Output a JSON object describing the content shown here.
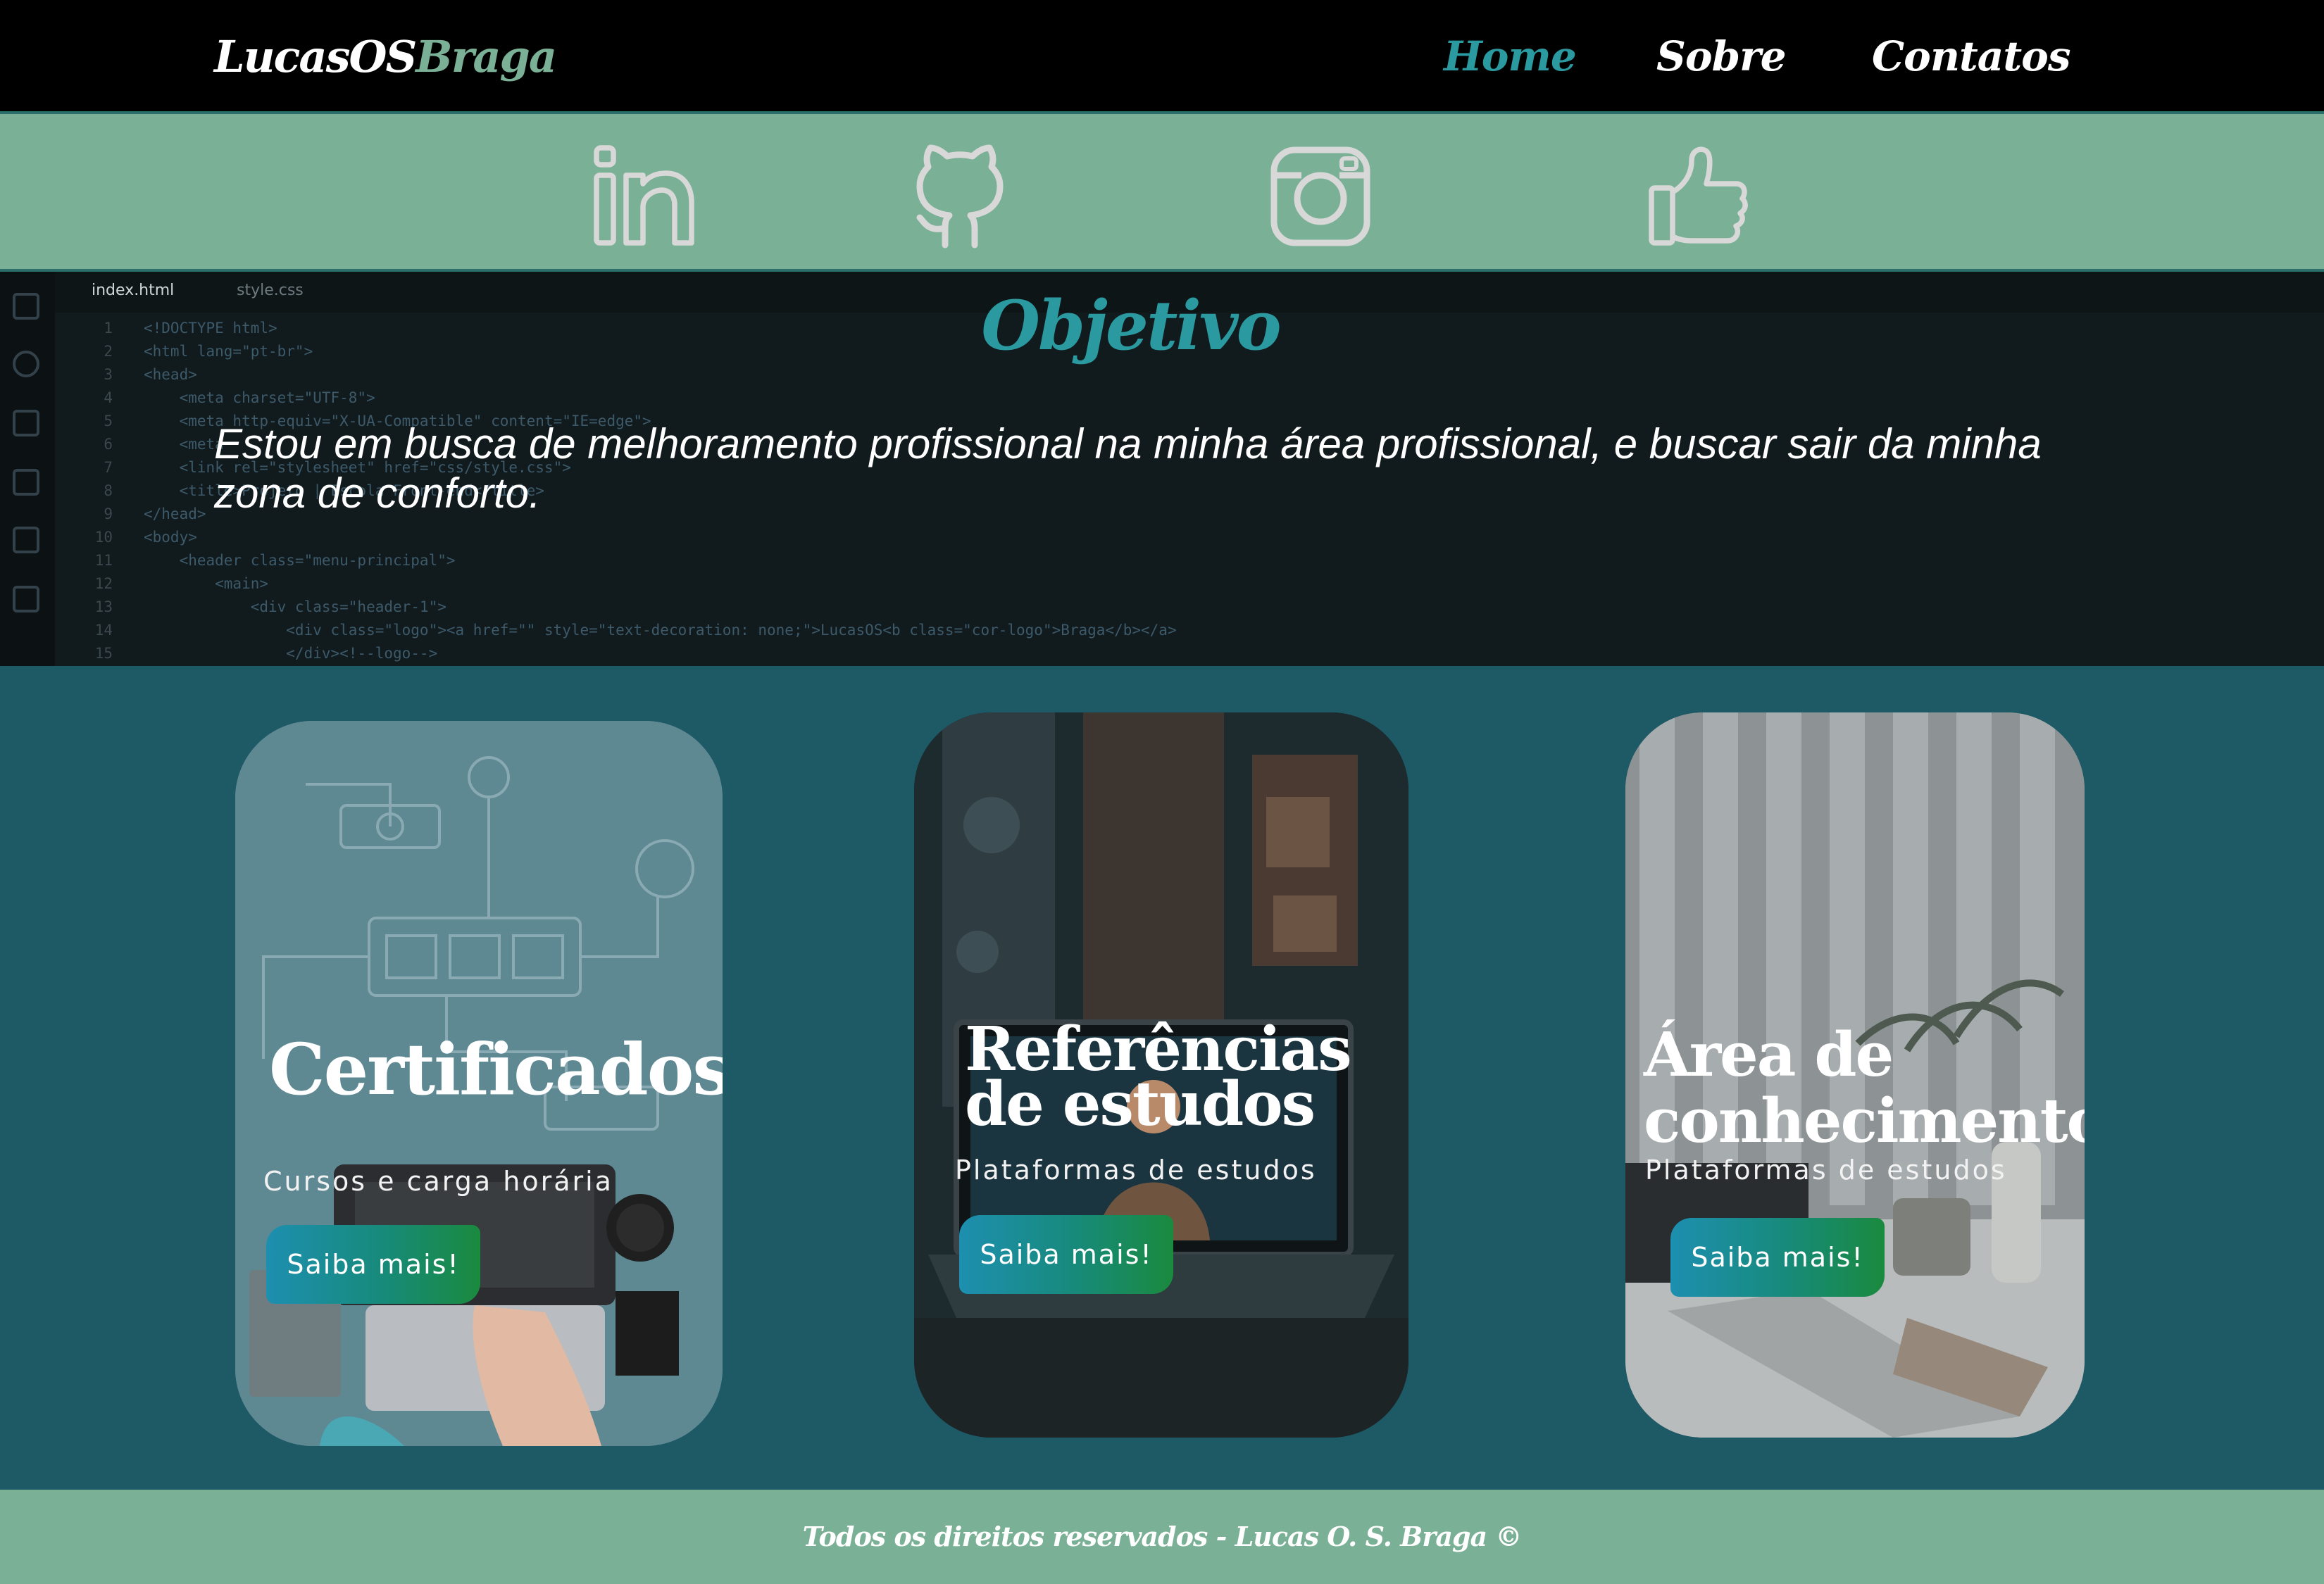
{
  "navbar": {
    "logo_main": "LucasOS",
    "logo_accent": "Braga",
    "links": [
      {
        "label": "Home",
        "active": true
      },
      {
        "label": "Sobre",
        "active": false
      },
      {
        "label": "Contatos",
        "active": false
      }
    ]
  },
  "social": {
    "icons": [
      "linkedin-icon",
      "github-icon",
      "instagram-icon",
      "thumbs-up-icon"
    ]
  },
  "hero": {
    "editor_tabs": [
      "index.html",
      "style.css"
    ],
    "code_lines": [
      {
        "n": "1",
        "text": "<!DOCTYPE html>"
      },
      {
        "n": "2",
        "text": "<html lang=\"pt-br\">"
      },
      {
        "n": "3",
        "text": "<head>"
      },
      {
        "n": "4",
        "text": "    <meta charset=\"UTF-8\">"
      },
      {
        "n": "5",
        "text": "    <meta http-equiv=\"X-UA-Compatible\" content=\"IE=edge\">"
      },
      {
        "n": "6",
        "text": "    <meta"
      },
      {
        "n": "7",
        "text": "    <link rel=\"stylesheet\" href=\"css/style.css\">"
      },
      {
        "n": "8",
        "text": "    <title>Projeto | Escola Front-end</title>"
      },
      {
        "n": "9",
        "text": "</head>"
      },
      {
        "n": "10",
        "text": "<body>"
      },
      {
        "n": "11",
        "text": "    <header class=\"menu-principal\">"
      },
      {
        "n": "12",
        "text": "        <main>"
      },
      {
        "n": "13",
        "text": "            <div class=\"header-1\">"
      },
      {
        "n": "14",
        "text": "                <div class=\"logo\"><a href=\"\" style=\"text-decoration: none;\">LucasOS<b class=\"cor-logo\">Braga</b></a>"
      },
      {
        "n": "15",
        "text": "                </div><!--logo-->"
      }
    ],
    "title": "Objetivo",
    "text": "Estou em busca de melhoramento profissional na minha área profissional, e buscar sair da minha zona de conforto."
  },
  "cards": [
    {
      "title": "Certificados",
      "subtitle": "Cursos e carga horária",
      "button": "Saiba mais!"
    },
    {
      "title": "Referências de estudos",
      "subtitle": "Plataformas de estudos",
      "button": "Saiba mais!"
    },
    {
      "title": "Área de conhecimento",
      "subtitle": "Plataformas de estudos",
      "button": "Saiba mais!"
    }
  ],
  "footer": {
    "text": "Todos os direitos reservados - Lucas O. S. Braga ©"
  },
  "colors": {
    "navbar_bg": "#000000",
    "accent_teal": "#2a9aa0",
    "social_bg": "#7ab095",
    "section_bg": "#1e5a66",
    "footer_bg": "#7ab095",
    "icon_gray": "#d8d8d8"
  }
}
